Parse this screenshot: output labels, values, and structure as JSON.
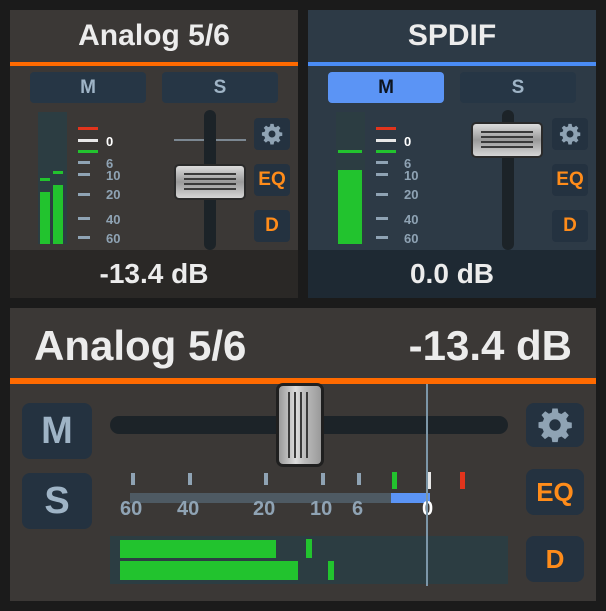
{
  "strips": [
    {
      "name": "Analog 5/6",
      "accent": "#ff6a00",
      "mute_label": "M",
      "solo_label": "S",
      "mute_active": false,
      "solo_active": false,
      "eq_label": "EQ",
      "d_label": "D",
      "gain": "-13.4 dB"
    },
    {
      "name": "SPDIF",
      "accent": "#4a8cf5",
      "mute_label": "M",
      "solo_label": "S",
      "mute_active": true,
      "solo_active": false,
      "eq_label": "EQ",
      "d_label": "D",
      "gain": "0.0 dB"
    }
  ],
  "meter_scale": [
    "0",
    "6",
    "10",
    "20",
    "40",
    "60"
  ],
  "detail": {
    "channel_name": "Analog 5/6",
    "gain": "-13.4 dB",
    "mute_label": "M",
    "solo_label": "S",
    "eq_label": "EQ",
    "d_label": "D",
    "scale_labels": [
      "60",
      "40",
      "20",
      "10",
      "6",
      "0"
    ]
  },
  "colors": {
    "analog_accent": "#ff6a00",
    "spdif_accent": "#4a8cf5",
    "meter_green": "#22c32e",
    "clip_red": "#e2341c",
    "mute_active": "#5b94f5",
    "eq_orange": "#ff8c1a"
  },
  "icons": [
    "gear-icon"
  ]
}
